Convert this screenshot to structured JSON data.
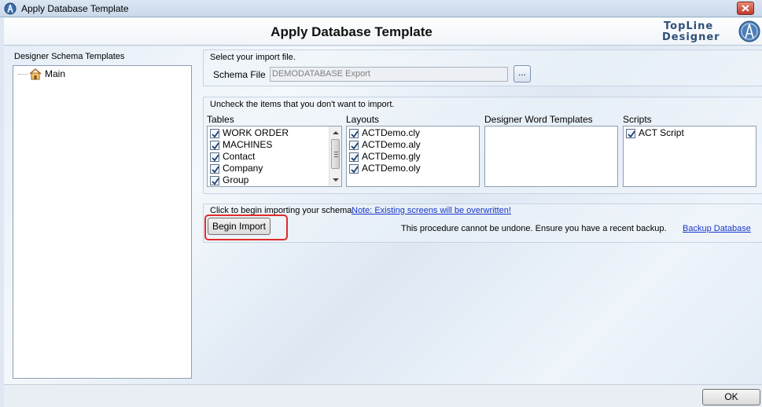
{
  "window": {
    "title": "Apply Database Template"
  },
  "header": {
    "heading": "Apply Database Template",
    "logo_line1": "TopLine",
    "logo_line2": "Designer"
  },
  "tree": {
    "label": "Designer Schema Templates",
    "items": [
      {
        "label": "Main",
        "icon": "house-icon"
      }
    ]
  },
  "import_file": {
    "group_label": "Select your import file.",
    "field_label": "Schema File",
    "field_value": "DEMODATABASE Export",
    "browse_label": "..."
  },
  "items": {
    "group_label": "Uncheck the items that you don't want to import.",
    "tables": {
      "label": "Tables",
      "rows": [
        {
          "label": "WORK ORDER",
          "checked": true
        },
        {
          "label": "MACHINES",
          "checked": true
        },
        {
          "label": "Contact",
          "checked": true
        },
        {
          "label": "Company",
          "checked": true
        },
        {
          "label": "Group",
          "checked": true
        }
      ]
    },
    "layouts": {
      "label": "Layouts",
      "rows": [
        {
          "label": "ACTDemo.cly",
          "checked": true
        },
        {
          "label": "ACTDemo.aly",
          "checked": true
        },
        {
          "label": "ACTDemo.gly",
          "checked": true
        },
        {
          "label": "ACTDemo.oly",
          "checked": true
        }
      ]
    },
    "word_templates": {
      "label": "Designer Word Templates",
      "rows": []
    },
    "scripts": {
      "label": "Scripts",
      "rows": [
        {
          "label": "ACT Script",
          "checked": true
        }
      ]
    }
  },
  "begin": {
    "instruction": "Click to begin importing your schema.",
    "note_link": "Note:  Existing screens will be overwritten!",
    "button_label": "Begin Import",
    "warning": "This procedure cannot be undone.   Ensure you have a recent backup.",
    "backup_link": "Backup Database",
    "highlight_color": "#e02a2a"
  },
  "footer": {
    "ok_label": "OK"
  },
  "colors": {
    "link": "#1a38c9",
    "background": "#eef3f8"
  }
}
